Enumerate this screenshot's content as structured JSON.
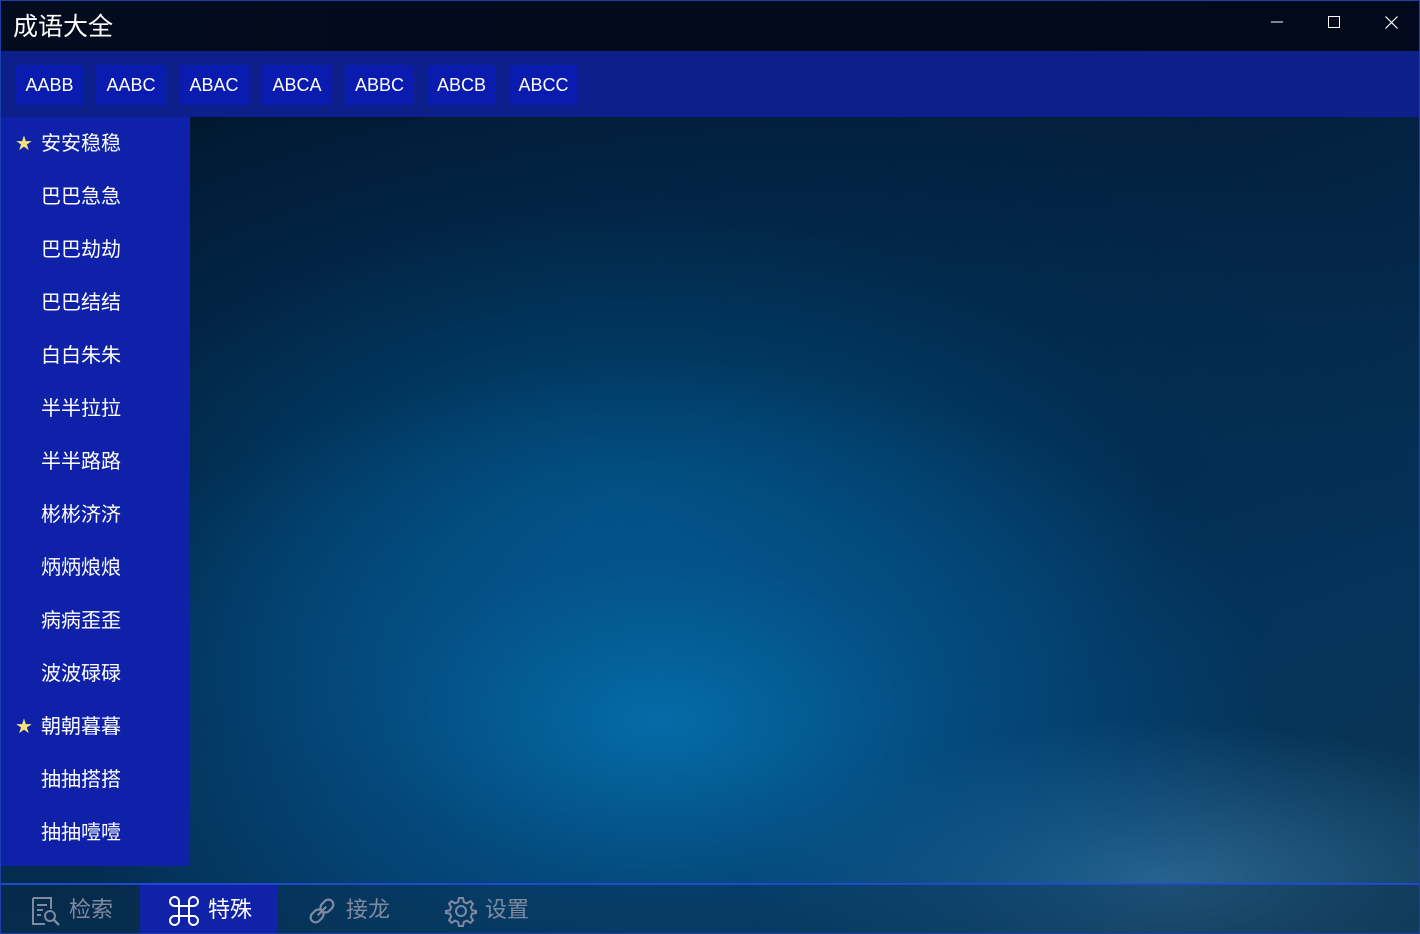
{
  "window": {
    "title": "成语大全"
  },
  "pattern_tabs": [
    "AABB",
    "AABC",
    "ABAC",
    "ABCA",
    "ABBC",
    "ABCB",
    "ABCC"
  ],
  "idioms": [
    {
      "label": "安安稳稳",
      "starred": true
    },
    {
      "label": "巴巴急急",
      "starred": false
    },
    {
      "label": "巴巴劫劫",
      "starred": false
    },
    {
      "label": "巴巴结结",
      "starred": false
    },
    {
      "label": "白白朱朱",
      "starred": false
    },
    {
      "label": "半半拉拉",
      "starred": false
    },
    {
      "label": "半半路路",
      "starred": false
    },
    {
      "label": "彬彬济济",
      "starred": false
    },
    {
      "label": "炳炳烺烺",
      "starred": false
    },
    {
      "label": "病病歪歪",
      "starred": false
    },
    {
      "label": "波波碌碌",
      "starred": false
    },
    {
      "label": "朝朝暮暮",
      "starred": true
    },
    {
      "label": "抽抽搭搭",
      "starred": false
    },
    {
      "label": "抽抽噎噎",
      "starred": false
    }
  ],
  "star_glyph": "★",
  "bottom_nav": [
    {
      "label": "检索",
      "icon": "search-doc-icon",
      "active": false
    },
    {
      "label": "特殊",
      "icon": "command-icon",
      "active": true
    },
    {
      "label": "接龙",
      "icon": "link-icon",
      "active": false
    },
    {
      "label": "设置",
      "icon": "gear-icon",
      "active": false
    }
  ],
  "colors": {
    "accent": "#0f21a8",
    "star": "#f4e27a",
    "inactive_text": "#7f8aa0"
  }
}
